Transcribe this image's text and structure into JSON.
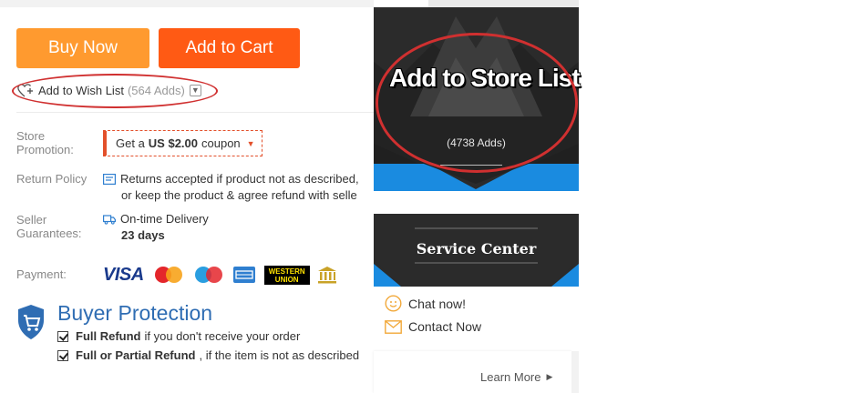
{
  "actions": {
    "buy_now": "Buy Now",
    "add_to_cart": "Add to Cart"
  },
  "wishlist": {
    "label": "Add to Wish List",
    "adds": "(564 Adds)"
  },
  "store_promotion": {
    "label": "Store Promotion:",
    "coupon_prefix": "Get a",
    "coupon_amount": "US $2.00",
    "coupon_suffix": "coupon"
  },
  "return_policy": {
    "label": "Return Policy",
    "line1": "Returns accepted if product not as described,",
    "line2": "or keep the product & agree refund with selle"
  },
  "seller_guarantees": {
    "label": "Seller Guarantees:",
    "delivery": "On-time Delivery",
    "days": "23 days"
  },
  "payment": {
    "label": "Payment:",
    "visa": "VISA",
    "western_union_1": "WESTERN",
    "western_union_2": "UNION",
    "methods": [
      "visa",
      "mastercard",
      "maestro",
      "american-express",
      "western-union",
      "bank-transfer"
    ]
  },
  "buyer_protection": {
    "title": "Buyer Protection",
    "items": [
      {
        "bold": "Full Refund",
        "text": "if you don't receive your order"
      },
      {
        "bold": "Full or Partial Refund",
        "text": ", if the item is not as described"
      }
    ],
    "learn_more": "Learn More"
  },
  "side_panel": {
    "store_list_title": "Add to Store List",
    "store_list_adds": "(4738 Adds)",
    "service_center": "Service Center",
    "chat": "Chat now!",
    "contact": "Contact Now"
  },
  "colors": {
    "buy_now": "#ff9a2f",
    "add_to_cart": "#ff5a14",
    "coupon_border": "#e3502b",
    "annotation_circle": "#d03030",
    "buyer_protection_blue": "#2f6db3",
    "panel_dark": "#2b2b2b",
    "panel_blue": "#1a8be0"
  }
}
